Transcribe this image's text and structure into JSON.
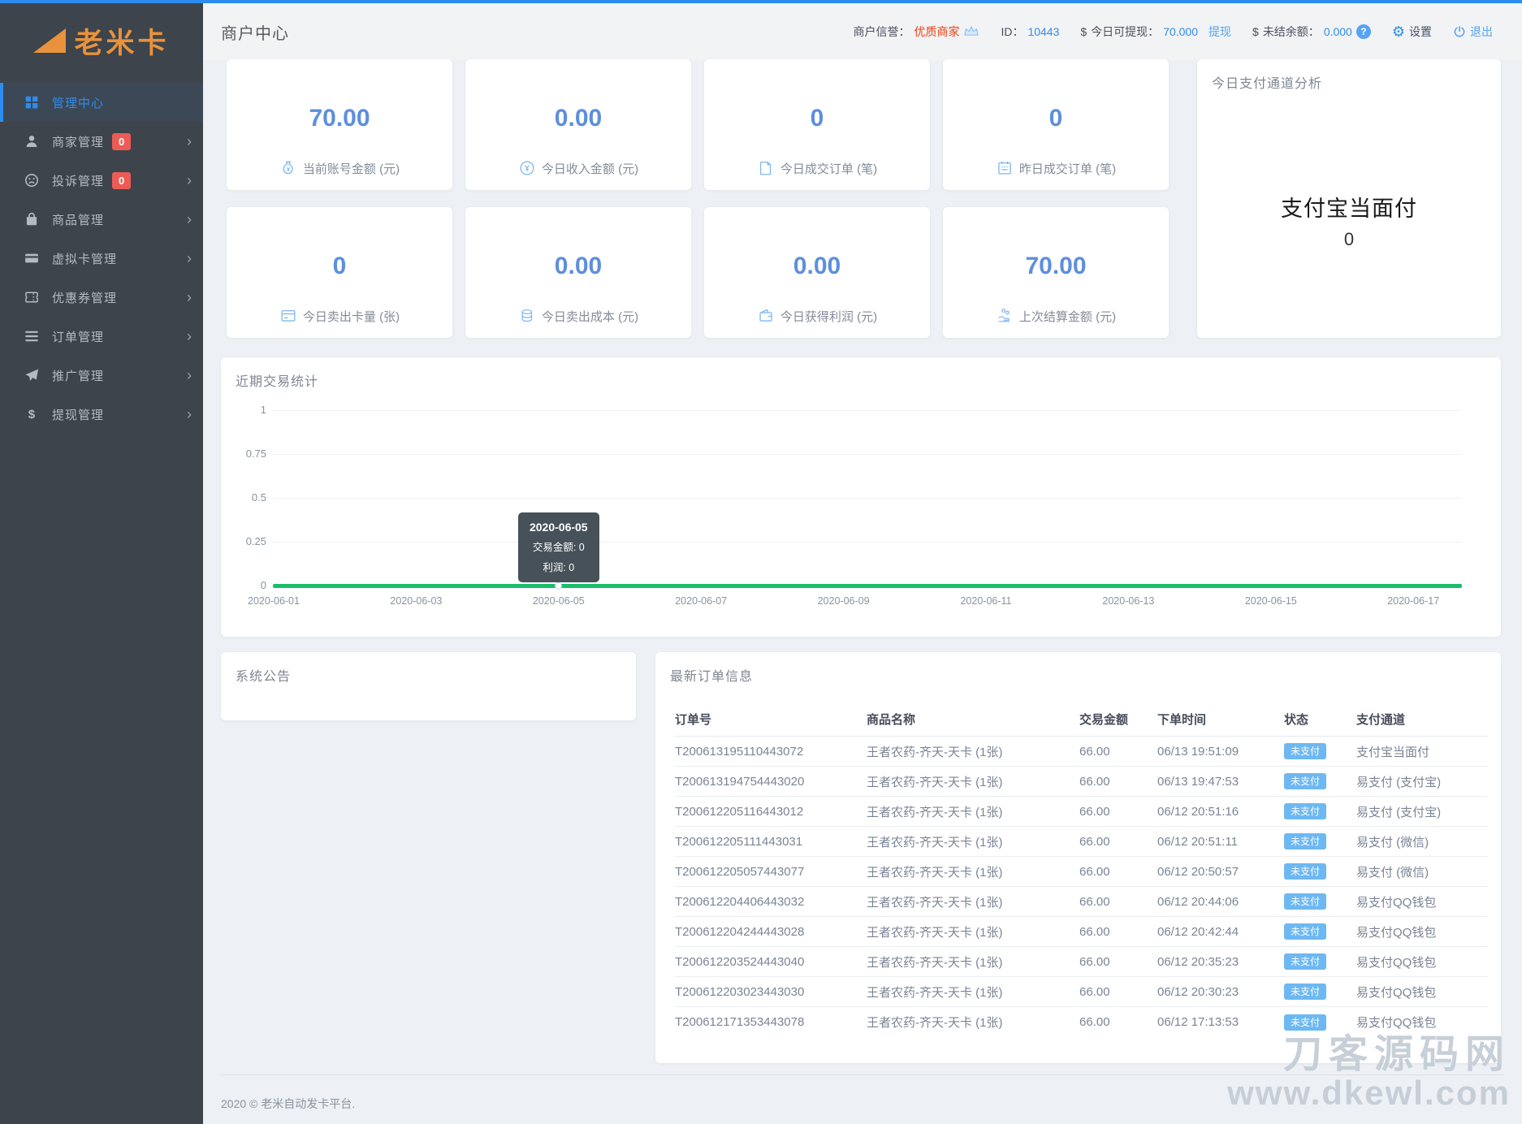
{
  "colors": {
    "primary": "#2d8cf0",
    "stat_number": "#5d8fdd",
    "chart_line_green": "#19be6b",
    "badge_red": "#ed5b56",
    "status_badge_blue": "#6db8f2",
    "logo_orange": "#e8923c"
  },
  "sidebar": {
    "logo_text": "老米卡",
    "chevron_glyph": "›",
    "items": [
      {
        "icon": "dashboard-icon",
        "label": "管理中心",
        "badge": null,
        "chevron": false,
        "active": true
      },
      {
        "icon": "merchant-icon",
        "label": "商家管理",
        "badge": "0",
        "chevron": true,
        "active": false
      },
      {
        "icon": "complaint-icon",
        "label": "投诉管理",
        "badge": "0",
        "chevron": true,
        "active": false
      },
      {
        "icon": "product-icon",
        "label": "商品管理",
        "badge": null,
        "chevron": true,
        "active": false
      },
      {
        "icon": "virtual-card-icon",
        "label": "虚拟卡管理",
        "badge": null,
        "chevron": true,
        "active": false
      },
      {
        "icon": "coupon-icon",
        "label": "优惠券管理",
        "badge": null,
        "chevron": true,
        "active": false
      },
      {
        "icon": "order-icon",
        "label": "订单管理",
        "badge": null,
        "chevron": true,
        "active": false
      },
      {
        "icon": "promotion-icon",
        "label": "推广管理",
        "badge": null,
        "chevron": true,
        "active": false
      },
      {
        "icon": "withdraw-icon",
        "label": "提现管理",
        "badge": null,
        "chevron": true,
        "active": false
      }
    ]
  },
  "header": {
    "title": "商户中心",
    "reputation_label": "商户信誉：",
    "reputation_value": "优质商家",
    "id_label": "ID：",
    "id_value": "10443",
    "currency_symbol": "$",
    "withdrawable_label": "今日可提现：",
    "withdrawable_value": "70.000",
    "withdraw_link": "提现",
    "unsettled_label": "未结余额：",
    "unsettled_value": "0.000",
    "help_glyph": "?",
    "gear_glyph": "⚙",
    "settings_label": "设置",
    "logout_label": "退出"
  },
  "stats": [
    {
      "value": "70.00",
      "label": "当前账号金额 (元)",
      "icon": "money-bag-icon"
    },
    {
      "value": "0.00",
      "label": "今日收入金额 (元)",
      "icon": "yen-circle-icon"
    },
    {
      "value": "0",
      "label": "今日成交订单 (笔)",
      "icon": "clipboard-icon"
    },
    {
      "value": "0",
      "label": "昨日成交订单 (笔)",
      "icon": "calendar-icon"
    },
    {
      "value": "0",
      "label": "今日卖出卡量 (张)",
      "icon": "sell-card-icon"
    },
    {
      "value": "0.00",
      "label": "今日卖出成本 (元)",
      "icon": "coins-icon"
    },
    {
      "value": "0.00",
      "label": "今日获得利润 (元)",
      "icon": "wallet-icon"
    },
    {
      "value": "70.00",
      "label": "上次结算金额 (元)",
      "icon": "hand-coins-icon"
    }
  ],
  "payment_panel": {
    "title": "今日支付通道分析",
    "channel": "支付宝当面付",
    "value": "0"
  },
  "chart_panel_title": "近期交易统计",
  "chart_data": {
    "type": "line",
    "title": "近期交易统计",
    "x": [
      "2020-06-01",
      "2020-06-03",
      "2020-06-05",
      "2020-06-07",
      "2020-06-09",
      "2020-06-11",
      "2020-06-13",
      "2020-06-15",
      "2020-06-17"
    ],
    "series": [
      {
        "name": "交易金额",
        "values": [
          0,
          0,
          0,
          0,
          0,
          0,
          0,
          0,
          0
        ]
      },
      {
        "name": "利润",
        "values": [
          0,
          0,
          0,
          0,
          0,
          0,
          0,
          0,
          0
        ]
      }
    ],
    "ylim": [
      0,
      1
    ],
    "yticks": [
      "1",
      "0.75",
      "0.5",
      "0.25",
      "0"
    ],
    "grid": true,
    "legend_position": "none",
    "tooltip": {
      "date": "2020-06-05",
      "lines": [
        "交易金额: 0",
        "利润: 0"
      ],
      "highlight_x": "2020-06-05"
    }
  },
  "announcement": {
    "title": "系统公告"
  },
  "orders": {
    "title": "最新订单信息",
    "columns": [
      "订单号",
      "商品名称",
      "交易金额",
      "下单时间",
      "状态",
      "支付通道"
    ],
    "rows": [
      {
        "order_no": "T200613195110443072",
        "product": "王者农药-齐天-天卡 (1张)",
        "amount": "66.00",
        "time": "06/13 19:51:09",
        "status": "未支付",
        "channel": "支付宝当面付"
      },
      {
        "order_no": "T200613194754443020",
        "product": "王者农药-齐天-天卡 (1张)",
        "amount": "66.00",
        "time": "06/13 19:47:53",
        "status": "未支付",
        "channel": "易支付 (支付宝)"
      },
      {
        "order_no": "T200612205116443012",
        "product": "王者农药-齐天-天卡 (1张)",
        "amount": "66.00",
        "time": "06/12 20:51:16",
        "status": "未支付",
        "channel": "易支付 (支付宝)"
      },
      {
        "order_no": "T200612205111443031",
        "product": "王者农药-齐天-天卡 (1张)",
        "amount": "66.00",
        "time": "06/12 20:51:11",
        "status": "未支付",
        "channel": "易支付 (微信)"
      },
      {
        "order_no": "T200612205057443077",
        "product": "王者农药-齐天-天卡 (1张)",
        "amount": "66.00",
        "time": "06/12 20:50:57",
        "status": "未支付",
        "channel": "易支付 (微信)"
      },
      {
        "order_no": "T200612204406443032",
        "product": "王者农药-齐天-天卡 (1张)",
        "amount": "66.00",
        "time": "06/12 20:44:06",
        "status": "未支付",
        "channel": "易支付QQ钱包"
      },
      {
        "order_no": "T200612204244443028",
        "product": "王者农药-齐天-天卡 (1张)",
        "amount": "66.00",
        "time": "06/12 20:42:44",
        "status": "未支付",
        "channel": "易支付QQ钱包"
      },
      {
        "order_no": "T200612203524443040",
        "product": "王者农药-齐天-天卡 (1张)",
        "amount": "66.00",
        "time": "06/12 20:35:23",
        "status": "未支付",
        "channel": "易支付QQ钱包"
      },
      {
        "order_no": "T200612203023443030",
        "product": "王者农药-齐天-天卡 (1张)",
        "amount": "66.00",
        "time": "06/12 20:30:23",
        "status": "未支付",
        "channel": "易支付QQ钱包"
      },
      {
        "order_no": "T200612171353443078",
        "product": "王者农药-齐天-天卡 (1张)",
        "amount": "66.00",
        "time": "06/12 17:13:53",
        "status": "未支付",
        "channel": "易支付QQ钱包"
      }
    ]
  },
  "footer": {
    "text": "2020 © 老米自动发卡平台."
  },
  "watermark": {
    "line1": "刀客源码网",
    "line2": "www.dkewl.com"
  }
}
